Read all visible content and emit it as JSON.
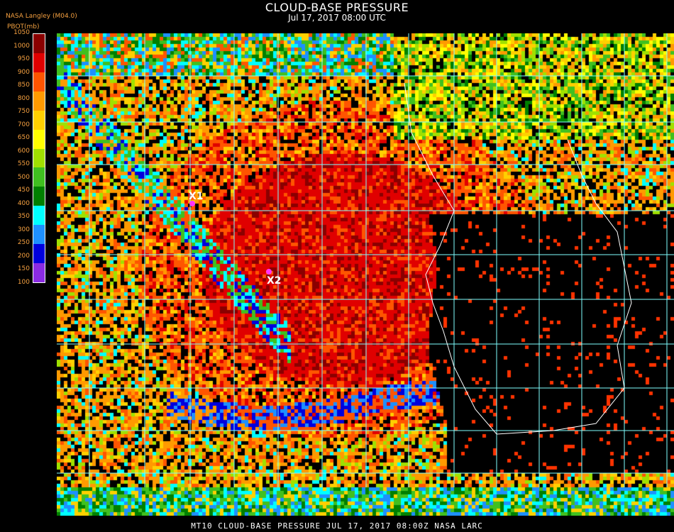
{
  "header": {
    "title": "CLOUD-BASE PRESSURE",
    "subtitle": "Jul 17, 2017 08:00 UTC",
    "agency": "NASA Langley (M04.0)",
    "unit_label": "PBOT(mb)"
  },
  "legend": {
    "ticks": [
      "1050",
      "1000",
      "950",
      "900",
      "850",
      "800",
      "750",
      "700",
      "650",
      "600",
      "550",
      "500",
      "450",
      "400",
      "350",
      "300",
      "250",
      "200",
      "150",
      "100"
    ],
    "colors": [
      "#8a0000",
      "#e00000",
      "#ff5500",
      "#ff9a00",
      "#ffd000",
      "#ffff00",
      "#a0e000",
      "#40c020",
      "#008000",
      "#00ffff",
      "#1e90ff",
      "#0000dd",
      "#8a2be2"
    ]
  },
  "markers": [
    {
      "label": "X1"
    },
    {
      "label": "X2"
    }
  ],
  "footer": "MT10   CLOUD-BASE PRESSURE   JUL 17, 2017 08:00Z   NASA LARC"
}
